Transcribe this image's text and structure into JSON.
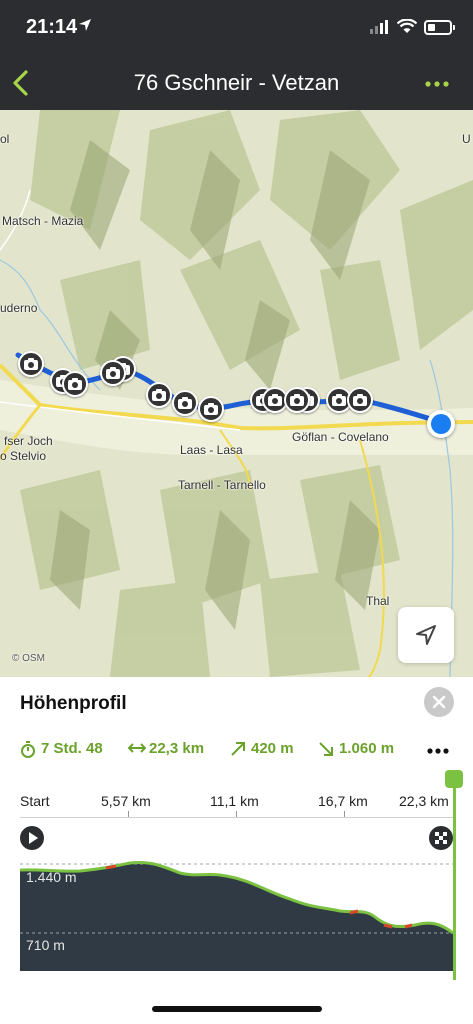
{
  "status": {
    "time": "21:14"
  },
  "nav": {
    "title": "76 Gschneir - Vetzan"
  },
  "map": {
    "places": [
      "Matsch - Mazia",
      "uderno",
      "ol",
      "fser Joch",
      "o Stelvio",
      "Laas - Lasa",
      "Göflan - Covelano",
      "Tarnell - Tarnello",
      "Thal",
      "U"
    ],
    "attribution": "© OSM",
    "route_color": "#1f5fd6",
    "marker_icon": "camera-icon"
  },
  "profile": {
    "heading": "Höhenprofil",
    "stats": {
      "duration": "7 Std. 48",
      "distance": "22,3 km",
      "ascent": "420 m",
      "descent": "1.060 m"
    },
    "axis_ticks": [
      "Start",
      "5,57 km",
      "11,1 km",
      "16,7 km",
      "22,3 km"
    ],
    "y_labels": [
      "1.440 m",
      "710 m"
    ],
    "line_color": "#7cc242",
    "fill_color": "#2f3a44"
  }
}
